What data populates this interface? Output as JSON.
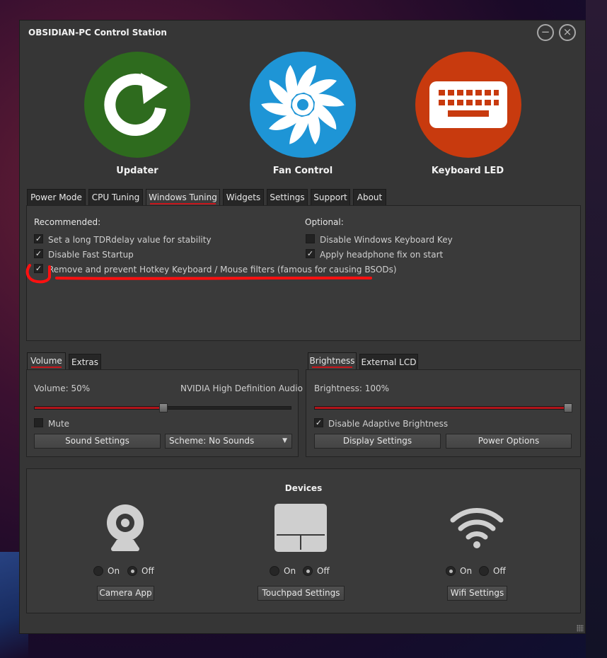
{
  "window": {
    "title": "OBSIDIAN-PC Control Station",
    "minimize_glyph": "−",
    "close_glyph": "×"
  },
  "big_buttons": [
    {
      "label": "Updater",
      "icon": "refresh-icon",
      "color": "#2e6b1e"
    },
    {
      "label": "Fan Control",
      "icon": "fan-icon",
      "color": "#1e95d6"
    },
    {
      "label": "Keyboard LED",
      "icon": "keyboard-icon",
      "color": "#c83a0e"
    }
  ],
  "main_tabs": [
    "Power Mode",
    "CPU Tuning",
    "Windows Tuning",
    "Widgets",
    "Settings",
    "Support",
    "About"
  ],
  "main_tab_active": "Windows Tuning",
  "tuning": {
    "recommended_label": "Recommended:",
    "optional_label": "Optional:",
    "recommended": [
      {
        "label": "Set a long TDRdelay value for stability",
        "checked": true
      },
      {
        "label": "Disable Fast Startup",
        "checked": true
      },
      {
        "label": "Remove and prevent Hotkey Keyboard / Mouse filters (famous for causing BSODs)",
        "checked": true
      }
    ],
    "optional": [
      {
        "label": "Disable Windows Keyboard Key",
        "checked": false
      },
      {
        "label": "Apply headphone fix on start",
        "checked": true
      }
    ],
    "check_glyph": "✓"
  },
  "volume": {
    "tabs": [
      "Volume",
      "Extras"
    ],
    "active_tab": "Volume",
    "label": "Volume: 50%",
    "level": 0.5,
    "device": "NVIDIA High Definition Audio",
    "mute_label": "Mute",
    "mute_checked": false,
    "sound_settings_label": "Sound Settings",
    "scheme_label": "Scheme: No Sounds",
    "scheme_arrow": "▼"
  },
  "brightness": {
    "tabs": [
      "Brightness",
      "External LCD"
    ],
    "active_tab": "Brightness",
    "label": "Brightness: 100%",
    "level": 1.0,
    "adaptive_label": "Disable Adaptive Brightness",
    "adaptive_checked": true,
    "display_settings_label": "Display Settings",
    "power_options_label": "Power Options"
  },
  "devices": {
    "title": "Devices",
    "items": [
      {
        "icon": "webcam-icon",
        "on_label": "On",
        "off_label": "Off",
        "state": "off",
        "button": "Camera App"
      },
      {
        "icon": "touchpad-icon",
        "on_label": "On",
        "off_label": "Off",
        "state": "off",
        "button": "Touchpad Settings"
      },
      {
        "icon": "wifi-icon",
        "on_label": "On",
        "off_label": "Off",
        "state": "on",
        "button": "Wifi Settings"
      }
    ]
  },
  "colors": {
    "accent": "#c8161c",
    "annotation": "#ff1010",
    "panel": "#3a3a3a",
    "window": "#363636"
  }
}
